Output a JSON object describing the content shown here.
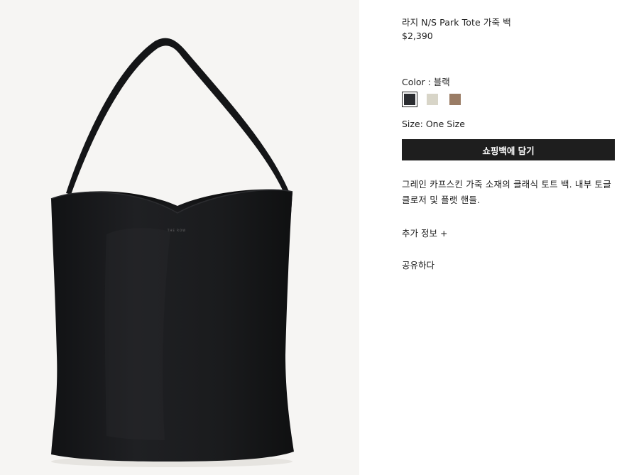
{
  "product": {
    "title": "라지 N/S Park Tote 가죽 백",
    "price": "$2,390",
    "image_alt": "black-leather-tote-bag",
    "logo_text": "THE ROW",
    "color": {
      "label": "Color : 블랙",
      "swatches": [
        {
          "name": "black",
          "hex": "#2b2d31",
          "selected": true
        },
        {
          "name": "ivory",
          "hex": "#d8d5c8",
          "selected": false
        },
        {
          "name": "taupe",
          "hex": "#9a7c65",
          "selected": false
        }
      ]
    },
    "size_label": "Size: One Size",
    "add_to_bag_label": "쇼핑백에 담기",
    "description": "그레인 카프스킨 가죽 소재의 클래식 토트 백. 내부 토글 클로저 및 플랫 핸들.",
    "more_info_label": "추가 정보 +",
    "share_label": "공유하다"
  },
  "colors": {
    "image_bg": "#f6f5f3",
    "bag": "#1a1b1d",
    "button_bg": "#1e1e1e",
    "text": "#1d1d1d"
  }
}
